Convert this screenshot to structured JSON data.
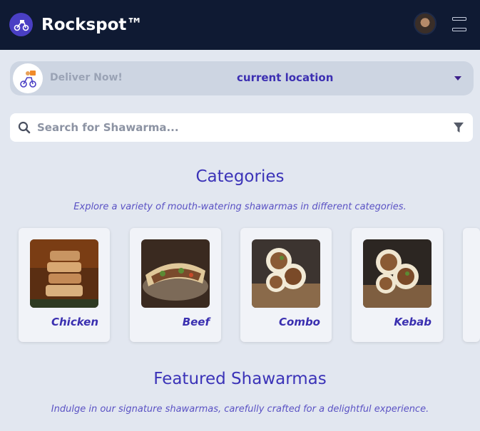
{
  "header": {
    "app_title": "Rockspot™",
    "logo_icon": "scooter-logo-icon",
    "avatar_icon": "user-avatar",
    "menu_icon": "menu-icon"
  },
  "delivery": {
    "label": "Deliver Now!",
    "location": "current location",
    "image_icon": "delivery-rider-icon",
    "caret_icon": "caret-down-icon"
  },
  "search": {
    "placeholder": "Search for Shawarma...",
    "value": "",
    "search_icon": "search-icon",
    "filter_icon": "filter-icon"
  },
  "categories": {
    "title": "Categories",
    "subtitle": "Explore a variety of mouth-watering shawarmas in different categories.",
    "items": [
      {
        "label": "Chicken"
      },
      {
        "label": "Beef"
      },
      {
        "label": "Combo"
      },
      {
        "label": "Kebab"
      }
    ]
  },
  "featured": {
    "title": "Featured Shawarmas",
    "subtitle": "Indulge in our signature shawarmas, carefully crafted for a delightful experience."
  },
  "colors": {
    "header_bg": "#0f1a33",
    "page_bg": "#e2e7f0",
    "accent": "#3b33b8"
  }
}
